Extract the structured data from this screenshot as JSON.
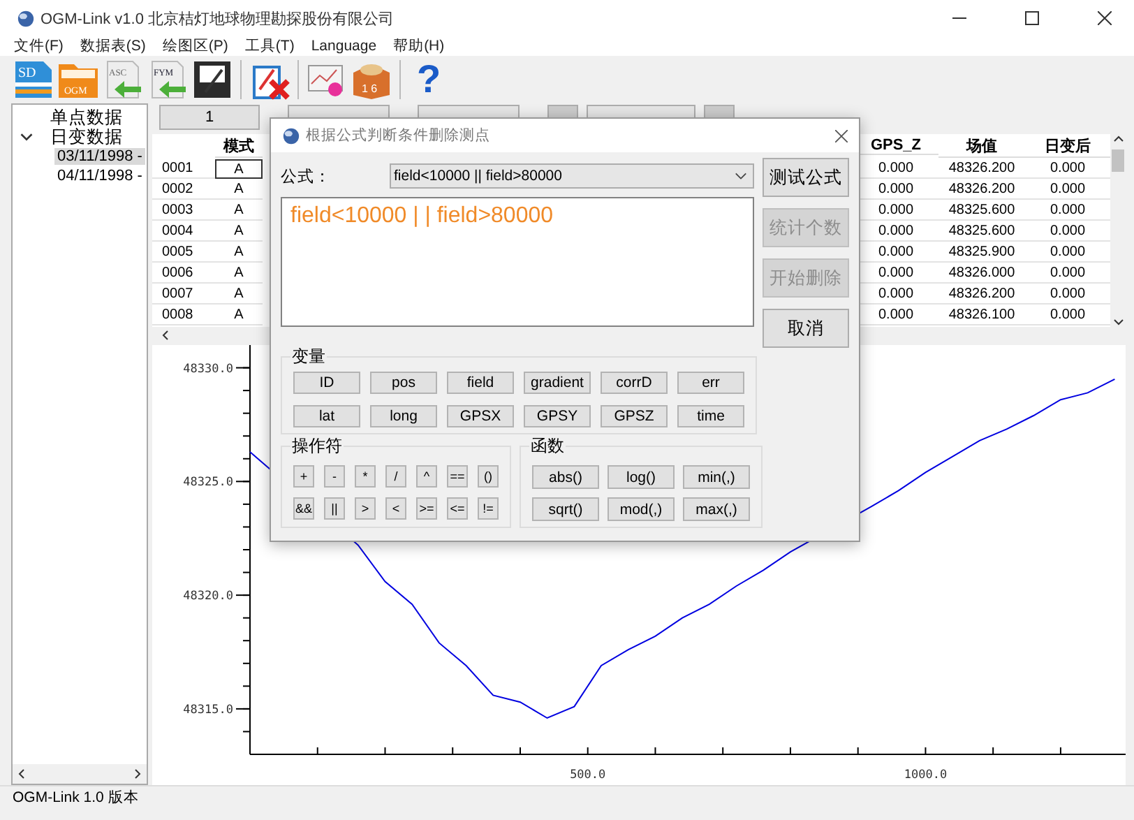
{
  "window": {
    "title": "OGM-Link v1.0 北京桔灯地球物理勘探股份有限公司"
  },
  "menu": [
    "文件(F)",
    "数据表(S)",
    "绘图区(P)",
    "工具(T)",
    "Language",
    "帮助(H)"
  ],
  "toolbar": [
    [
      {
        "kind": "sd",
        "label": "SD"
      },
      {
        "kind": "ogm",
        "label": "OGM"
      },
      {
        "kind": "asc",
        "label": "ASC"
      },
      {
        "kind": "fym",
        "label": "FYM"
      },
      {
        "kind": "save"
      }
    ],
    [
      {
        "kind": "delete"
      }
    ],
    [
      {
        "kind": "image"
      },
      {
        "kind": "box",
        "label": "1 6"
      }
    ],
    [
      {
        "kind": "help",
        "label": "?"
      }
    ]
  ],
  "tree": [
    {
      "label": "单点数据",
      "selected": false
    },
    {
      "label": "日变数据",
      "selected": false,
      "expanded": true,
      "children": [
        {
          "label": "03/11/1998 -",
          "selected": true
        },
        {
          "label": "04/11/1998 -",
          "selected": false
        }
      ]
    }
  ],
  "pager": {
    "current": "1"
  },
  "table": {
    "columns": [
      "模式",
      "GPS_Z",
      "场值",
      "日变后"
    ],
    "rows": [
      {
        "id": "0001",
        "mode": "A",
        "gps_z": "0.000",
        "field": "48326.200",
        "corrected": "0.000",
        "current": true
      },
      {
        "id": "0002",
        "mode": "A",
        "gps_z": "0.000",
        "field": "48326.200",
        "corrected": "0.000",
        "current": false
      },
      {
        "id": "0003",
        "mode": "A",
        "gps_z": "0.000",
        "field": "48325.600",
        "corrected": "0.000",
        "current": false
      },
      {
        "id": "0004",
        "mode": "A",
        "gps_z": "0.000",
        "field": "48325.600",
        "corrected": "0.000",
        "current": false
      },
      {
        "id": "0005",
        "mode": "A",
        "gps_z": "0.000",
        "field": "48325.900",
        "corrected": "0.000",
        "current": false
      },
      {
        "id": "0006",
        "mode": "A",
        "gps_z": "0.000",
        "field": "48326.000",
        "corrected": "0.000",
        "current": false
      },
      {
        "id": "0007",
        "mode": "A",
        "gps_z": "0.000",
        "field": "48326.200",
        "corrected": "0.000",
        "current": false
      },
      {
        "id": "0008",
        "mode": "A",
        "gps_z": "0.000",
        "field": "48326.100",
        "corrected": "0.000",
        "current": false
      }
    ]
  },
  "chart": {
    "chart_data": {
      "type": "line",
      "xlim": [
        0,
        1290
      ],
      "ylim": [
        48313,
        48331
      ],
      "xticks": [
        {
          "value": 500,
          "label": "500.0"
        },
        {
          "value": 1000,
          "label": "1000.0"
        }
      ],
      "yticks": [
        {
          "value": 48315,
          "label": "48315.0"
        },
        {
          "value": 48320,
          "label": "48320.0"
        },
        {
          "value": 48325,
          "label": "48325.0"
        },
        {
          "value": 48330,
          "label": "48330.0"
        }
      ],
      "x": [
        0,
        160,
        200,
        240,
        280,
        320,
        360,
        400,
        440,
        480,
        520,
        560,
        600,
        640,
        680,
        720,
        760,
        800,
        920,
        960,
        1000,
        1040,
        1080,
        1120,
        1160,
        1200,
        1240,
        1280
      ],
      "series": [
        {
          "color": "#0000e0",
          "values": [
            48326.3,
            48322.2,
            48320.6,
            48319.6,
            48317.9,
            48316.9,
            48315.6,
            48315.3,
            48314.6,
            48315.1,
            48316.9,
            48317.6,
            48318.2,
            48319.0,
            48319.6,
            48320.4,
            48321.1,
            48321.9,
            48323.9,
            48324.6,
            48325.4,
            48326.1,
            48326.8,
            48327.3,
            48327.9,
            48328.6,
            48328.9,
            48329.5
          ]
        }
      ]
    }
  },
  "status_bar": "OGM-Link 1.0 版本",
  "dialog": {
    "title": "根据公式判断条件删除测点",
    "formula_label": "公式：",
    "formula_select": "field<10000 || field>80000",
    "formula_text": "field<10000 | | field>80000",
    "buttons": [
      {
        "label": "测试公式",
        "disabled": false
      },
      {
        "label": "统计个数",
        "disabled": true
      },
      {
        "label": "开始删除",
        "disabled": true
      },
      {
        "label": "取消",
        "disabled": false
      }
    ],
    "variables_title": "变量",
    "variables": [
      "ID",
      "pos",
      "field",
      "gradient",
      "corrD",
      "err",
      "lat",
      "long",
      "GPSX",
      "GPSY",
      "GPSZ",
      "time"
    ],
    "operators_title": "操作符",
    "operators": [
      "+",
      "-",
      "*",
      "/",
      "^",
      "==",
      "()",
      "&&",
      "||",
      ">",
      "<",
      ">=",
      "<=",
      "!="
    ],
    "functions_title": "函数",
    "functions": [
      "abs()",
      "log()",
      "min(,)",
      "sqrt()",
      "mod(,)",
      "max(,)"
    ]
  }
}
